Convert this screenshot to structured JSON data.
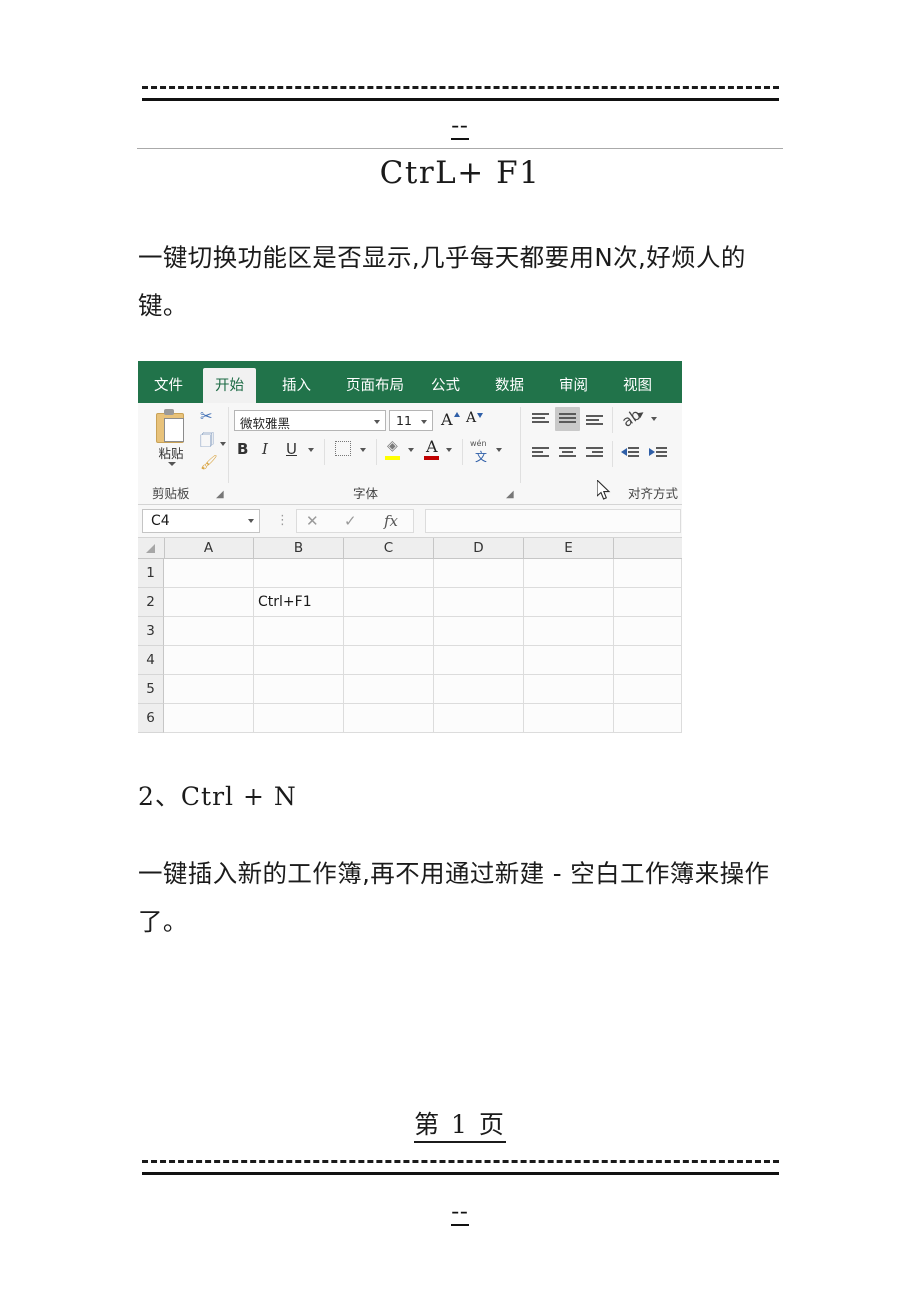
{
  "document": {
    "header": {
      "marker": "--"
    },
    "title": "CtrL+ F1",
    "paragraph1": "一键切换功能区是否显示,几乎每天都要用N次,好烦人的键。",
    "heading2": "2、Ctrl + N",
    "paragraph2": "一键插入新的工作簿,再不用通过新建 - 空白工作簿来操作了。",
    "footer": {
      "page_number": "第 1 页",
      "marker": "--"
    }
  },
  "excel": {
    "theme": {
      "ribbon_green": "#21734a",
      "active_tab_bg": "#f1f1f1",
      "active_tab_text": "#1d6b45",
      "ribbon_body_bg": "#f7f7f7"
    },
    "tabs": [
      {
        "label": "文件",
        "active": false
      },
      {
        "label": "开始",
        "active": true
      },
      {
        "label": "插入",
        "active": false
      },
      {
        "label": "页面布局",
        "active": false
      },
      {
        "label": "公式",
        "active": false
      },
      {
        "label": "数据",
        "active": false
      },
      {
        "label": "审阅",
        "active": false
      },
      {
        "label": "视图",
        "active": false
      }
    ],
    "groups": {
      "clipboard": {
        "label": "剪贴板",
        "paste_label": "粘贴",
        "icons": [
          "clipboard-icon",
          "scissors-icon",
          "copy-icon",
          "format-painter-icon"
        ],
        "launcher": "⌐"
      },
      "font": {
        "label": "字体",
        "font_name": "微软雅黑",
        "font_size": "11",
        "grow_font": "A",
        "shrink_font": "A",
        "bold": "B",
        "italic": "I",
        "underline": "U",
        "phonetic": "文",
        "phonetic_sup": "wén",
        "fill_color": "#ffff00",
        "font_color": "#c00000",
        "launcher": "⌐"
      },
      "alignment": {
        "label": "对齐方式"
      }
    },
    "formula_bar": {
      "name_box": "C4",
      "cancel": "✕",
      "confirm": "✓",
      "function": "fx",
      "value": ""
    },
    "sheet": {
      "columns": [
        "A",
        "B",
        "C",
        "D",
        "E"
      ],
      "rows": [
        "1",
        "2",
        "3",
        "4",
        "5",
        "6"
      ],
      "cells": [
        {
          "row": "2",
          "col": "B",
          "value": "Ctrl+F1"
        }
      ]
    },
    "cursor": "mouse-pointer"
  }
}
